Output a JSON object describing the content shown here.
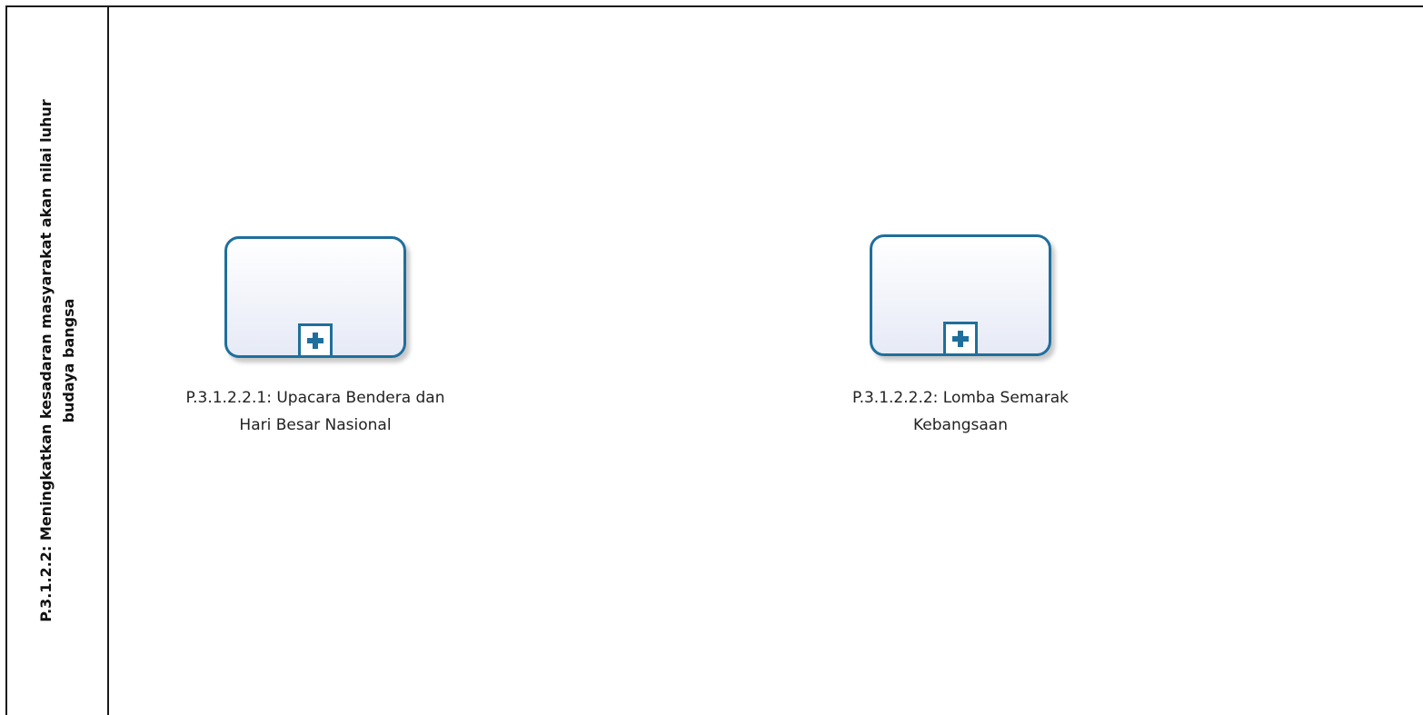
{
  "lane": {
    "label_line1": "P.3.1.2.2: Meningkatkan kesadaran masyarakat akan nilai luhur",
    "label_line2": "budaya bangsa"
  },
  "tasks": [
    {
      "label_line1": "P.3.1.2.2.1: Upacara Bendera dan",
      "label_line2": "Hari Besar Nasional",
      "marker_icon": "plus-icon"
    },
    {
      "label_line1": "P.3.1.2.2.2: Lomba Semarak",
      "label_line2": "Kebangsaan",
      "marker_icon": "plus-icon"
    }
  ],
  "colors": {
    "task_border": "#1f6f9c",
    "lane_border": "#1a1a1a"
  }
}
